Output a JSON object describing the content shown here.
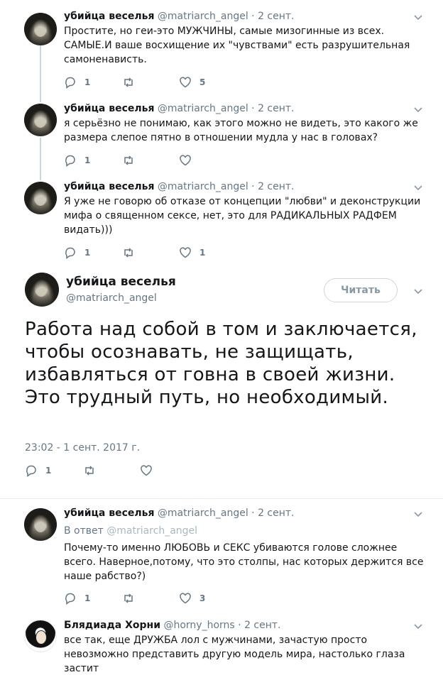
{
  "tweets": [
    {
      "name": "убийца веселья",
      "handle": "@matriarch_angel",
      "sep": "·",
      "time": "2 сент.",
      "text": "Простите, но геи-это МУЖЧИНЫ, самые мизогинные из всех. САМЫЕ.И ваше восхищение их \"чувствами\" есть разрушительная самоненависть.",
      "reply_count": "1",
      "retweet_count": "",
      "like_count": "5"
    },
    {
      "name": "убийца веселья",
      "handle": "@matriarch_angel",
      "sep": "·",
      "time": "2 сент.",
      "text": "я серьёзно не понимаю, как этого можно не видеть, это какого же размера слепое пятно в отношении мудла у нас в головах?",
      "reply_count": "1",
      "retweet_count": "",
      "like_count": ""
    },
    {
      "name": "убийца веселья",
      "handle": "@matriarch_angel",
      "sep": "·",
      "time": "2 сент.",
      "text": "Я уже не говорю об отказе от концепции \"любви\" и деконструкции мифа о священном сексе, нет, это для РАДИКАЛЬНЫХ РАДФЕМ видать)))",
      "reply_count": "1",
      "retweet_count": "",
      "like_count": "1"
    }
  ],
  "main": {
    "name": "убийца веселья",
    "handle": "@matriarch_angel",
    "follow_label": "Читать",
    "text": "Работа над собой в том и заключается, чтобы осознавать, не защищать, избавляться от говна в своей жизни. Это трудный путь, но необходимый.",
    "date": "23:02 - 1 сент. 2017 г.",
    "reply_count": "1",
    "retweet_count": "",
    "like_count": ""
  },
  "replies": [
    {
      "name": "убийца веселья",
      "handle": "@matriarch_angel",
      "sep": "·",
      "time": "2 сент.",
      "reply_to_label": "В ответ",
      "reply_to_handle": "@matriarch_angel",
      "text": "Почему-то именно ЛЮБОВЬ и СЕКС убиваются голове сложнее всего. Наверное,потому, что это столпы, нас которых держится все наше рабство?)",
      "reply_count": "1",
      "retweet_count": "",
      "like_count": "3"
    },
    {
      "name": "Блядиада Хорни",
      "handle": "@horny_horns",
      "sep": "·",
      "time": "2 сент.",
      "text": "все так, еще ДРУЖБА лол с мужчинами, зачастую просто невозможно представить другую модель мира, настолько глаза застит"
    }
  ],
  "icons": {
    "reply": "reply-icon",
    "retweet": "retweet-icon",
    "like": "heart-icon",
    "more": "chevron-down-icon"
  },
  "colors": {
    "text": "#14171a",
    "secondary": "#657786",
    "border": "#e6ecf0"
  }
}
